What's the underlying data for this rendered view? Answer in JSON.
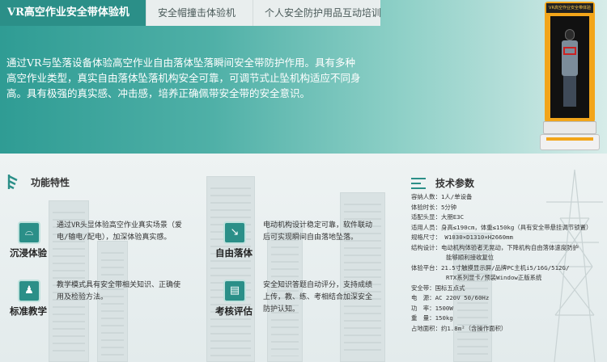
{
  "tabs": [
    {
      "label": "VR高空作业安全带体验机",
      "active": true
    },
    {
      "label": "安全帽撞击体验机",
      "active": false
    },
    {
      "label": "个人安全防护用品互动培训",
      "active": false
    }
  ],
  "intro": "通过VR与坠落设备体验高空作业自由落体坠落瞬间安全带防护作用。具有多种高空作业类型，真实自由落体坠落机构安全可靠，可调节式止坠机构适应不同身高。具有极强的真实感、冲击感，培养正确佩带安全带的安全意识。",
  "booth_sign": "VR高空作业安全带体验",
  "features": {
    "title": "功能特性",
    "items": [
      {
        "icon": "vr-headset-icon",
        "label": "沉浸体验",
        "desc": "通过VR头显体验高空作业真实场景（爱电/输电/配电），加深体验真实感。"
      },
      {
        "icon": "fall-icon",
        "label": "自由落体",
        "desc": "电动机构设计稳定可靠，软件联动后可实现瞬间自由落地坠落。"
      },
      {
        "icon": "teacher-icon",
        "label": "标准教学",
        "desc": "教学模式具有安全带相关知识、正确使用及检验方法。"
      },
      {
        "icon": "assessment-icon",
        "label": "考核评估",
        "desc": "安全知识答题自动评分，支持成绩上传，教、练、考相结合加深安全防护认知。"
      }
    ]
  },
  "tech": {
    "title": "技术参数",
    "rows": [
      {
        "text": "容纳人数：1人/单设备",
        "indent": false
      },
      {
        "text": "体验时长：5分钟",
        "indent": false
      },
      {
        "text": "适配头显：大朋E3C",
        "indent": false
      },
      {
        "text": "适用人员：身高≤190cm，体重≤150kg（具有安全带悬挂调节锁置）",
        "indent": false
      },
      {
        "text": "规格尺寸： W1030×D1310×H2660mm",
        "indent": false
      },
      {
        "text": "结构设计：电动机构体验者无晃动，下降机构自由落体速度防护",
        "indent": false
      },
      {
        "text": "能够顺利接收复位",
        "indent": true
      },
      {
        "text": "体验平台：21.5寸触摸显示屏/品牌PC主机i5/16G/512G/",
        "indent": false
      },
      {
        "text": "RTX系列显卡/预装Window正版系统",
        "indent": true
      },
      {
        "text": "安全带：国标五点式",
        "indent": false
      },
      {
        "text": "电　源：AC 220V 50/60Hz",
        "indent": false
      },
      {
        "text": "功　率：1500W",
        "indent": false
      },
      {
        "text": "重　量：150kg",
        "indent": false
      },
      {
        "text": "占地面积：约1.8m²（含操作面积）",
        "indent": false
      }
    ]
  },
  "colors": {
    "accent": "#2b8f88",
    "booth": "#f2a51a"
  }
}
